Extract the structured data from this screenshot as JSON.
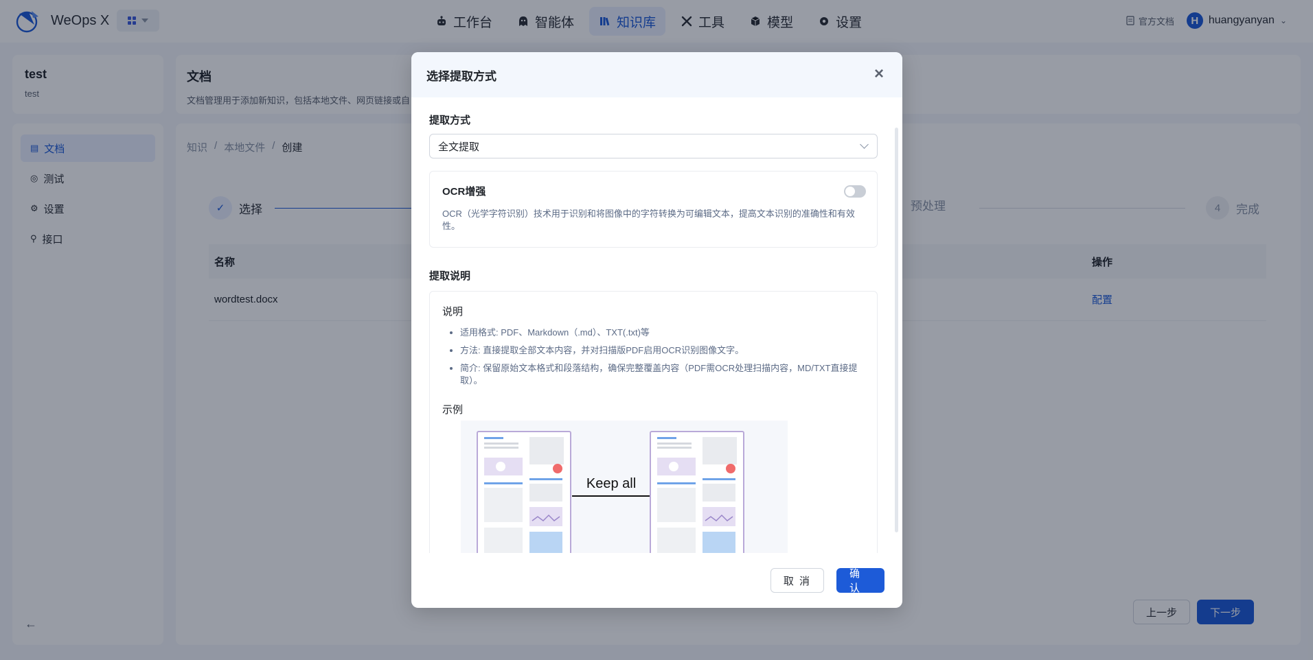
{
  "header": {
    "app_title": "WeOps X",
    "nav": [
      {
        "label": "工作台",
        "icon": "robot-icon"
      },
      {
        "label": "智能体",
        "icon": "agent-icon"
      },
      {
        "label": "知识库",
        "icon": "books-icon"
      },
      {
        "label": "工具",
        "icon": "tools-icon"
      },
      {
        "label": "模型",
        "icon": "cube-icon"
      },
      {
        "label": "设置",
        "icon": "gear-icon"
      }
    ],
    "active_nav": "知识库",
    "doc_link": "官方文档",
    "user_initial": "H",
    "username": "huangyanyan"
  },
  "project": {
    "name": "test",
    "desc": "test"
  },
  "sidebar": {
    "items": [
      {
        "label": "文档",
        "icon": "doc-icon"
      },
      {
        "label": "测试",
        "icon": "test-icon"
      },
      {
        "label": "设置",
        "icon": "settings-icon"
      },
      {
        "label": "接口",
        "icon": "link-icon"
      }
    ]
  },
  "main": {
    "title": "文档",
    "desc": "文档管理用于添加新知识，包括本地文件、网页链接或自",
    "breadcrumb": [
      "知识",
      "本地文件",
      "创建"
    ],
    "steps": [
      {
        "label": "选择",
        "marker": "✓"
      },
      {
        "label": "预处理",
        "marker": ""
      },
      {
        "label": "完成",
        "marker": "4"
      }
    ],
    "table": {
      "headers": {
        "name": "名称",
        "op": "操作"
      },
      "rows": [
        {
          "name": "wordtest.docx",
          "op": "配置"
        }
      ]
    },
    "prev_label": "上一步",
    "next_label": "下一步"
  },
  "modal": {
    "title": "选择提取方式",
    "method_label": "提取方式",
    "method_value": "全文提取",
    "ocr": {
      "title": "OCR增强",
      "enabled": false,
      "desc": "OCR（光学字符识别）技术用于识别和将图像中的字符转换为可编辑文本，提高文本识别的准确性和有效性。"
    },
    "desc_label": "提取说明",
    "desc_card": {
      "heading": "说明",
      "bullets": [
        "适用格式: PDF、Markdown（.md）、TXT(.txt)等",
        "方法: 直接提取全部文本内容，并对扫描版PDF启用OCR识别图像文字。",
        "简介: 保留原始文本格式和段落结构，确保完整覆盖内容（PDF需OCR处理扫描内容，MD/TXT直接提取）。"
      ],
      "example_heading": "示例",
      "example_caption": "Keep all"
    },
    "cancel_label": "取 消",
    "confirm_label": "确 认"
  },
  "colors": {
    "primary": "#1d5bd8",
    "overlay": "rgba(10,20,40,0.42)"
  }
}
